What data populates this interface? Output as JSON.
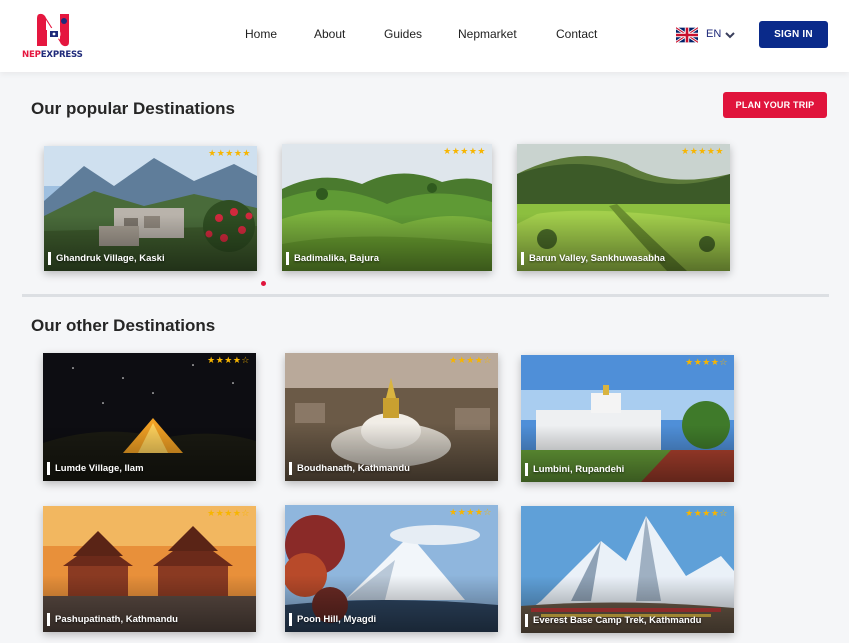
{
  "brand": {
    "name_part1": "NEP",
    "name_part2": "EXPRESS",
    "red": "#e5173f",
    "navy": "#1f2a7a"
  },
  "nav": {
    "items": [
      {
        "label": "Home"
      },
      {
        "label": "About"
      },
      {
        "label": "Guides"
      },
      {
        "label": "Nepmarket"
      },
      {
        "label": "Contact"
      }
    ]
  },
  "language": {
    "code": "EN",
    "flag": "uk-flag-icon",
    "chevron": "chevron-down-icon"
  },
  "signin_label": "SIGN IN",
  "popular": {
    "title": "Our popular Destinations",
    "plan_label": "PLAN YOUR TRIP",
    "carousel_active_dot": 1,
    "cards": [
      {
        "name": "Ghandruk Village, Kaski",
        "stars": "★★★★★"
      },
      {
        "name": "Badimalika, Bajura",
        "stars": "★★★★★"
      },
      {
        "name": "Barun Valley, Sankhuwasabha",
        "stars": "★★★★★"
      }
    ]
  },
  "other": {
    "title": "Our other Destinations",
    "cards": [
      {
        "name": "Lumde Village, Ilam",
        "stars": "★★★★☆"
      },
      {
        "name": "Boudhanath, Kathmandu",
        "stars": "★★★★☆"
      },
      {
        "name": "Lumbini, Rupandehi",
        "stars": "★★★★☆"
      },
      {
        "name": "Pashupatinath, Kathmandu",
        "stars": "★★★★☆"
      },
      {
        "name": "Poon Hill, Myagdi",
        "stars": "★★★★☆"
      },
      {
        "name": "Everest Base Camp Trek, Kathmandu",
        "stars": "★★★★☆"
      }
    ]
  },
  "colors": {
    "accent_red": "#e0143c",
    "button_navy": "#0a2a8a",
    "star": "#f7b500"
  }
}
